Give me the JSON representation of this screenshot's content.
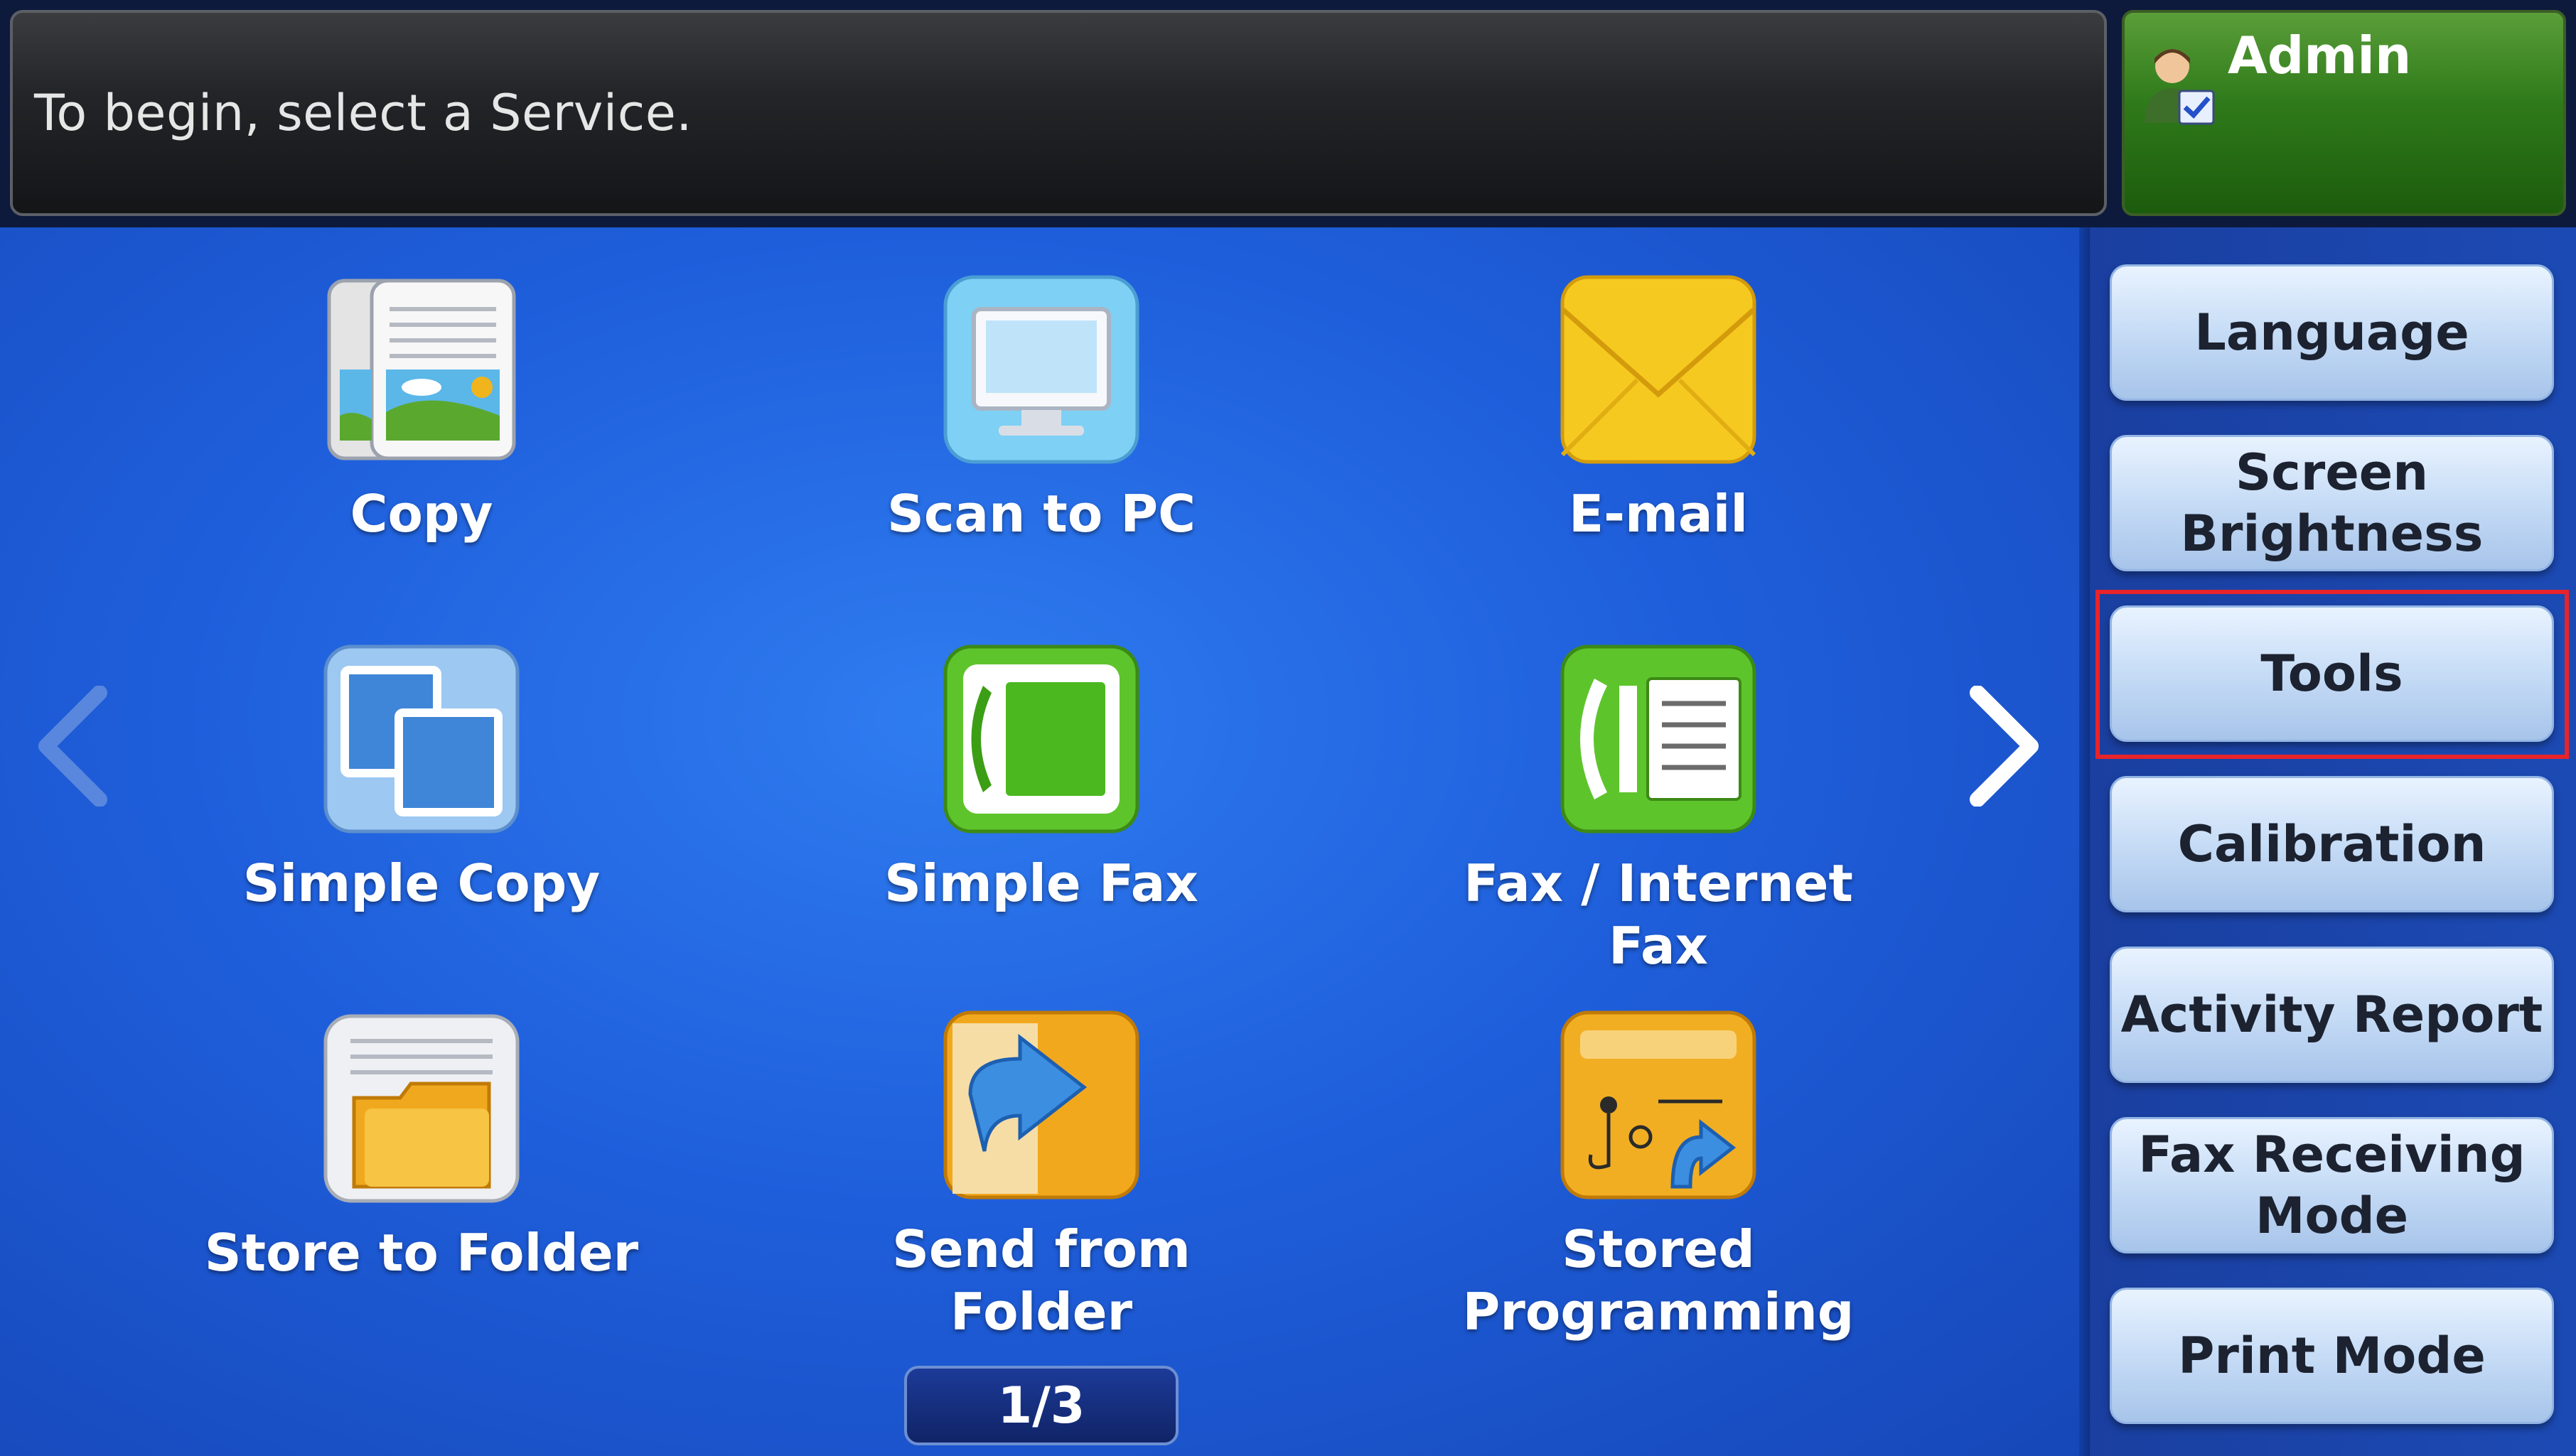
{
  "header": {
    "prompt": "To begin, select a Service."
  },
  "user": {
    "name": "Admin",
    "icon": "admin-user-icon"
  },
  "services": [
    {
      "label": "Copy",
      "icon": "copy-icon"
    },
    {
      "label": "Scan to PC",
      "icon": "scan-to-pc-icon"
    },
    {
      "label": "E-mail",
      "icon": "email-icon"
    },
    {
      "label": "Simple Copy",
      "icon": "simple-copy-icon"
    },
    {
      "label": "Simple Fax",
      "icon": "simple-fax-icon"
    },
    {
      "label": "Fax / Internet Fax",
      "icon": "fax-internet-fax-icon"
    },
    {
      "label": "Store to Folder",
      "icon": "store-to-folder-icon"
    },
    {
      "label": "Send from Folder",
      "icon": "send-from-folder-icon"
    },
    {
      "label": "Stored Programming",
      "icon": "stored-programming-icon"
    }
  ],
  "pager": {
    "current": "1/3"
  },
  "sidebar": {
    "buttons": [
      {
        "label": "Language"
      },
      {
        "label": "Screen Brightness"
      },
      {
        "label": "Tools",
        "highlighted": true
      },
      {
        "label": "Calibration"
      },
      {
        "label": "Activity Report"
      },
      {
        "label": "Fax Receiving Mode"
      },
      {
        "label": "Print Mode"
      }
    ]
  },
  "colors": {
    "highlight": "#e8242a",
    "admin_green": "#2f7a1a",
    "screen_blue": "#1f5fdc"
  }
}
